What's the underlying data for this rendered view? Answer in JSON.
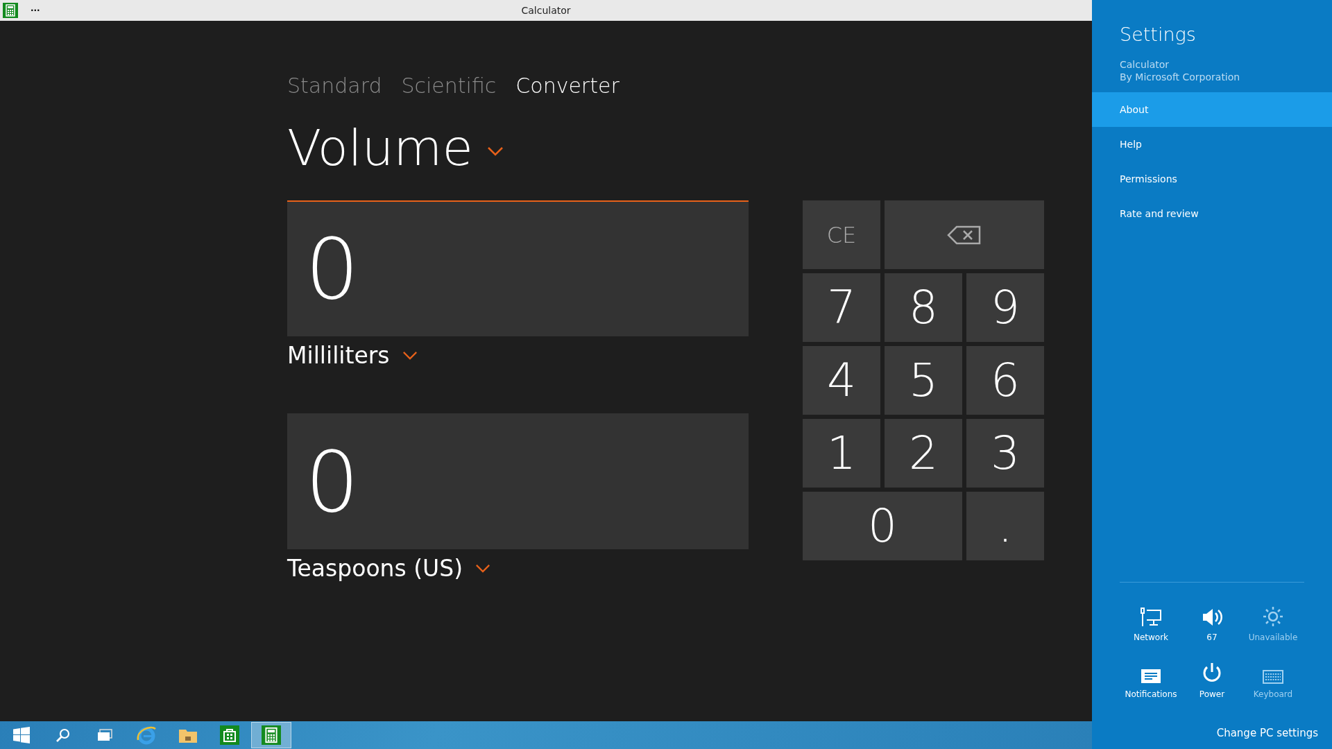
{
  "window": {
    "title": "Calculator",
    "menu": "···"
  },
  "tabs": [
    {
      "label": "Standard",
      "selected": false
    },
    {
      "label": "Scientific",
      "selected": false
    },
    {
      "label": "Converter",
      "selected": true
    }
  ],
  "category": "Volume",
  "converter": [
    {
      "value": "0",
      "unit": "Milliliters",
      "active": true
    },
    {
      "value": "0",
      "unit": "Teaspoons (US)",
      "active": false
    }
  ],
  "keypad": [
    {
      "kind": "text",
      "label": "CE"
    },
    {
      "kind": "backspace"
    },
    {
      "kind": "text",
      "label": "7"
    },
    {
      "kind": "text",
      "label": "8"
    },
    {
      "kind": "text",
      "label": "9"
    },
    {
      "kind": "text",
      "label": "4"
    },
    {
      "kind": "text",
      "label": "5"
    },
    {
      "kind": "text",
      "label": "6"
    },
    {
      "kind": "text",
      "label": "1"
    },
    {
      "kind": "text",
      "label": "2"
    },
    {
      "kind": "text",
      "label": "3"
    },
    {
      "kind": "wide",
      "label": "0"
    },
    {
      "kind": "text",
      "label": "."
    }
  ],
  "settings": {
    "title": "Settings",
    "app": "Calculator",
    "publisher": "By Microsoft Corporation",
    "items": [
      {
        "label": "About",
        "selected": true
      },
      {
        "label": "Help",
        "selected": false
      },
      {
        "label": "Permissions",
        "selected": false
      },
      {
        "label": "Rate and review",
        "selected": false
      }
    ],
    "quick": [
      {
        "kind": "network",
        "label": "Network",
        "disabled": false
      },
      {
        "kind": "volume",
        "label": "67",
        "disabled": false
      },
      {
        "kind": "brightness",
        "label": "Unavailable",
        "disabled": true
      },
      {
        "kind": "notifications",
        "label": "Notifications",
        "disabled": false
      },
      {
        "kind": "power",
        "label": "Power",
        "disabled": false
      },
      {
        "kind": "keyboard",
        "label": "Keyboard",
        "disabled": true
      }
    ],
    "change_link": "Change PC settings"
  },
  "taskbar": [
    {
      "kind": "start",
      "selected": false
    },
    {
      "kind": "search",
      "selected": false
    },
    {
      "kind": "taskview",
      "selected": false
    },
    {
      "kind": "browser",
      "selected": false
    },
    {
      "kind": "folder",
      "selected": false
    },
    {
      "kind": "store",
      "selected": false
    },
    {
      "kind": "calculator",
      "selected": true
    }
  ]
}
